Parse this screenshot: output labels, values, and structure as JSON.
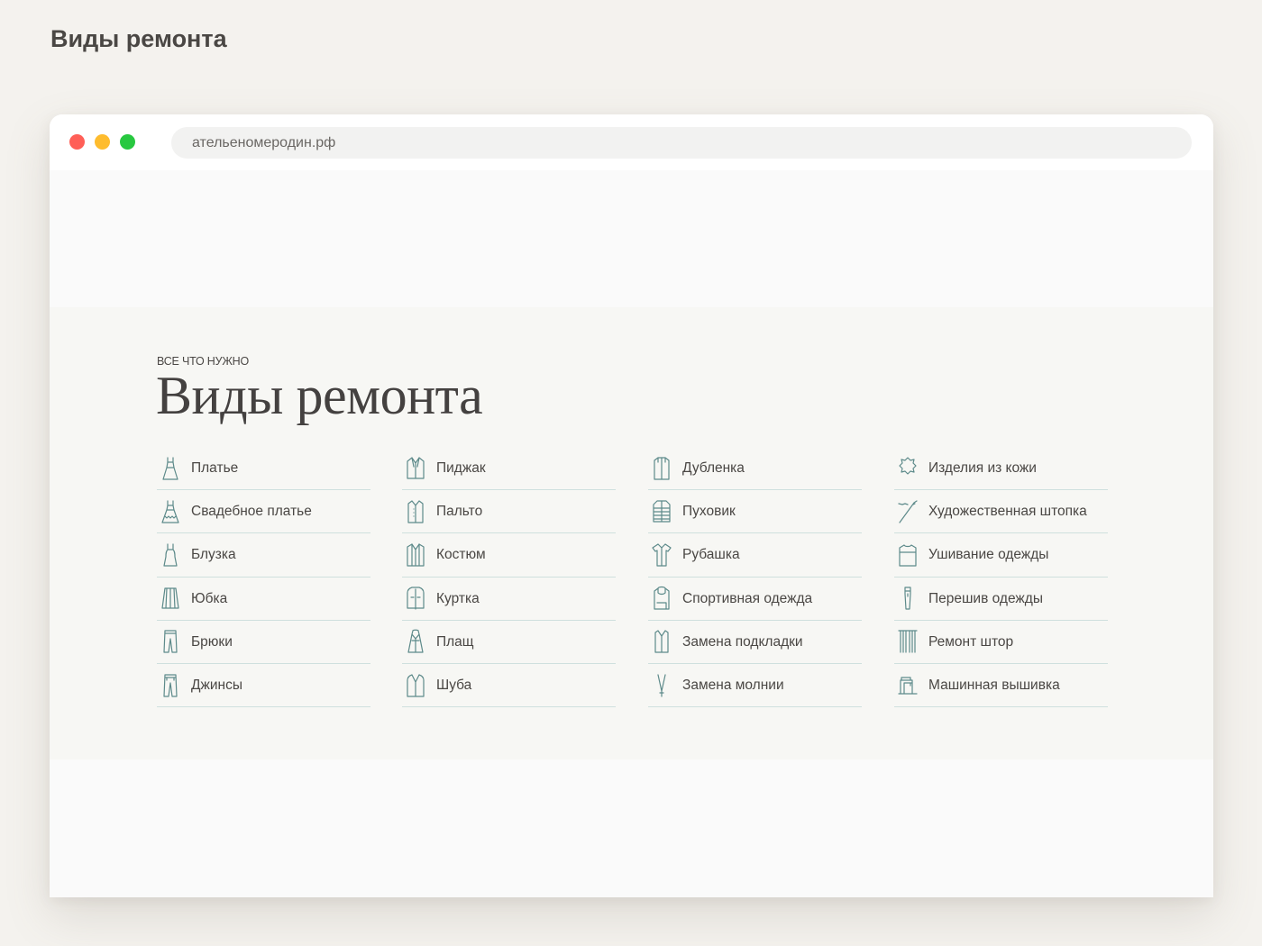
{
  "page": {
    "heading": "Виды ремонта"
  },
  "browser": {
    "url": "ательеномеродин.рф"
  },
  "section": {
    "eyebrow": "ВСЕ ЧТО НУЖНО",
    "title": "Виды ремонта",
    "columns": [
      [
        {
          "label": "Платье",
          "icon": "dress-icon"
        },
        {
          "label": "Свадебное платье",
          "icon": "wedding-dress-icon"
        },
        {
          "label": "Блузка",
          "icon": "blouse-icon"
        },
        {
          "label": "Юбка",
          "icon": "skirt-icon"
        },
        {
          "label": "Брюки",
          "icon": "trousers-icon"
        },
        {
          "label": "Джинсы",
          "icon": "jeans-icon"
        }
      ],
      [
        {
          "label": "Пиджак",
          "icon": "blazer-icon"
        },
        {
          "label": "Пальто",
          "icon": "coat-icon"
        },
        {
          "label": "Костюм",
          "icon": "suit-icon"
        },
        {
          "label": "Куртка",
          "icon": "jacket-icon"
        },
        {
          "label": "Плащ",
          "icon": "raincoat-icon"
        },
        {
          "label": "Шуба",
          "icon": "fur-coat-icon"
        }
      ],
      [
        {
          "label": "Дубленка",
          "icon": "sheepskin-coat-icon"
        },
        {
          "label": "Пуховик",
          "icon": "down-jacket-icon"
        },
        {
          "label": "Рубашка",
          "icon": "shirt-icon"
        },
        {
          "label": "Спортивная одежда",
          "icon": "hoodie-icon"
        },
        {
          "label": "Замена подкладки",
          "icon": "vest-icon"
        },
        {
          "label": "Замена молнии",
          "icon": "zipper-icon"
        }
      ],
      [
        {
          "label": "Изделия из кожи",
          "icon": "leather-icon"
        },
        {
          "label": "Художественная штопка",
          "icon": "needle-icon"
        },
        {
          "label": "Ушивание одежды",
          "icon": "sweater-icon"
        },
        {
          "label": "Перешив одежды",
          "icon": "alteration-icon"
        },
        {
          "label": "Ремонт штор",
          "icon": "curtains-icon"
        },
        {
          "label": "Машинная вышивка",
          "icon": "sewing-machine-icon"
        }
      ]
    ]
  },
  "colors": {
    "background": "#f4f2ee",
    "icon_stroke": "#5d8a8a",
    "divider": "#cfe0de",
    "text": "#4a4744"
  }
}
